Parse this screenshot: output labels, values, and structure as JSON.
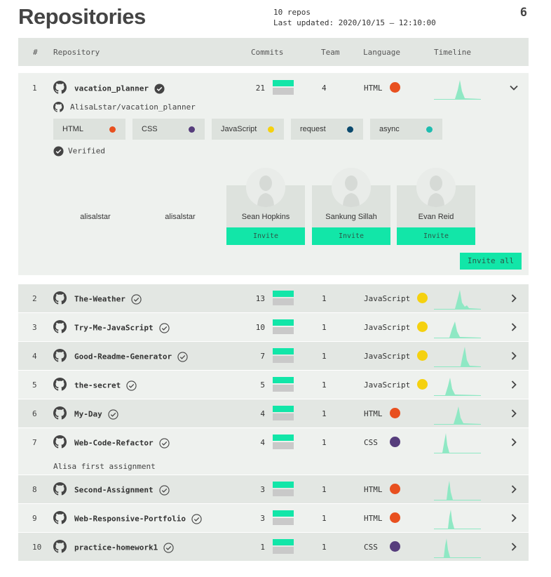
{
  "header": {
    "title": "Repositories",
    "repo_count_text": "10 repos",
    "last_updated": "Last updated: 2020/10/15 — 12:10:00",
    "count": "6"
  },
  "columns": {
    "num": "#",
    "repository": "Repository",
    "commits": "Commits",
    "team": "Team",
    "language": "Language",
    "timeline": "Timeline"
  },
  "expanded": {
    "num": "1",
    "name": "vacation_planner",
    "commits": "21",
    "team": "4",
    "language": "HTML",
    "language_color": "#e8501f",
    "full_name": "AlisaLstar/vacation_planner",
    "tags": [
      {
        "label": "HTML",
        "color": "#e8501f"
      },
      {
        "label": "CSS",
        "color": "#563d7c"
      },
      {
        "label": "JavaScript",
        "color": "#f5d10f"
      },
      {
        "label": "request",
        "color": "#0b4a6e"
      },
      {
        "label": "async",
        "color": "#1fbdb0"
      }
    ],
    "verified_label": "Verified",
    "owners": [
      "alisalstar",
      "alisalstar"
    ],
    "invitees": [
      {
        "name": "Sean Hopkins",
        "invite": "Invite"
      },
      {
        "name": "Sankung Sillah",
        "invite": "Invite"
      },
      {
        "name": "Evan Reid",
        "invite": "Invite"
      }
    ],
    "invite_all": "Invite all"
  },
  "repos": [
    {
      "num": "2",
      "name": "The-Weather",
      "commits": "13",
      "team": "1",
      "language": "JavaScript",
      "language_color": "#f5d10f"
    },
    {
      "num": "3",
      "name": "Try-Me-JavaScript",
      "commits": "10",
      "team": "1",
      "language": "JavaScript",
      "language_color": "#f5d10f"
    },
    {
      "num": "4",
      "name": "Good-Readme-Generator",
      "commits": "7",
      "team": "1",
      "language": "JavaScript",
      "language_color": "#f5d10f"
    },
    {
      "num": "5",
      "name": "the-secret",
      "commits": "5",
      "team": "1",
      "language": "JavaScript",
      "language_color": "#f5d10f"
    },
    {
      "num": "6",
      "name": "My-Day",
      "commits": "4",
      "team": "1",
      "language": "HTML",
      "language_color": "#e8501f"
    },
    {
      "num": "7",
      "name": "Web-Code-Refactor",
      "commits": "4",
      "team": "1",
      "language": "CSS",
      "language_color": "#563d7c",
      "description": "Alisa first assignment"
    },
    {
      "num": "8",
      "name": "Second-Assignment",
      "commits": "3",
      "team": "1",
      "language": "HTML",
      "language_color": "#e8501f"
    },
    {
      "num": "9",
      "name": "Web-Responsive-Portfolio",
      "commits": "3",
      "team": "1",
      "language": "HTML",
      "language_color": "#e8501f"
    },
    {
      "num": "10",
      "name": "practice-homework1",
      "commits": "1",
      "team": "1",
      "language": "CSS",
      "language_color": "#563d7c"
    }
  ],
  "colors": {
    "accent": "#12e6a8",
    "spark_fill": "#8fe8c4",
    "row_alt": "#e3e7e3",
    "row_plain": "#eef1ee"
  }
}
